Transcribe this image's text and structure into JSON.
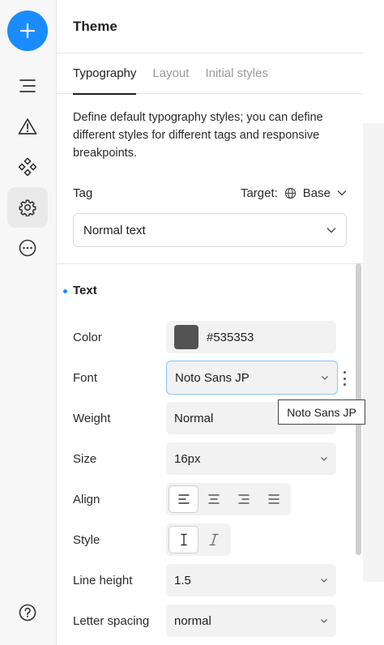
{
  "rail": {
    "items": [
      "add",
      "outline",
      "warnings",
      "components",
      "settings",
      "more",
      "help"
    ]
  },
  "panel": {
    "title": "Theme",
    "tabs": [
      {
        "label": "Typography",
        "active": true
      },
      {
        "label": "Layout",
        "active": false
      },
      {
        "label": "Initial styles",
        "active": false
      }
    ],
    "description": "Define default typography styles; you can define different styles for different tags and responsive breakpoints.",
    "tag_label": "Tag",
    "target_label": "Target:",
    "target_value": "Base",
    "tag_select_value": "Normal text"
  },
  "text_section": {
    "title": "Text",
    "color": {
      "label": "Color",
      "value": "#535353"
    },
    "font": {
      "label": "Font",
      "value": "Noto Sans JP"
    },
    "weight": {
      "label": "Weight",
      "value": "Normal"
    },
    "size": {
      "label": "Size",
      "value": "16px"
    },
    "align": {
      "label": "Align",
      "options": [
        "left",
        "center",
        "right",
        "justify"
      ],
      "selected": "left"
    },
    "style": {
      "label": "Style",
      "options": [
        "normal",
        "italic"
      ],
      "selected": "normal"
    },
    "line_height": {
      "label": "Line height",
      "value": "1.5"
    },
    "letter_spacing": {
      "label": "Letter spacing",
      "value": "normal"
    }
  },
  "tooltip": {
    "text": "Noto Sans JP"
  },
  "colors": {
    "accent": "#1a8cff",
    "swatch": "#535353"
  }
}
